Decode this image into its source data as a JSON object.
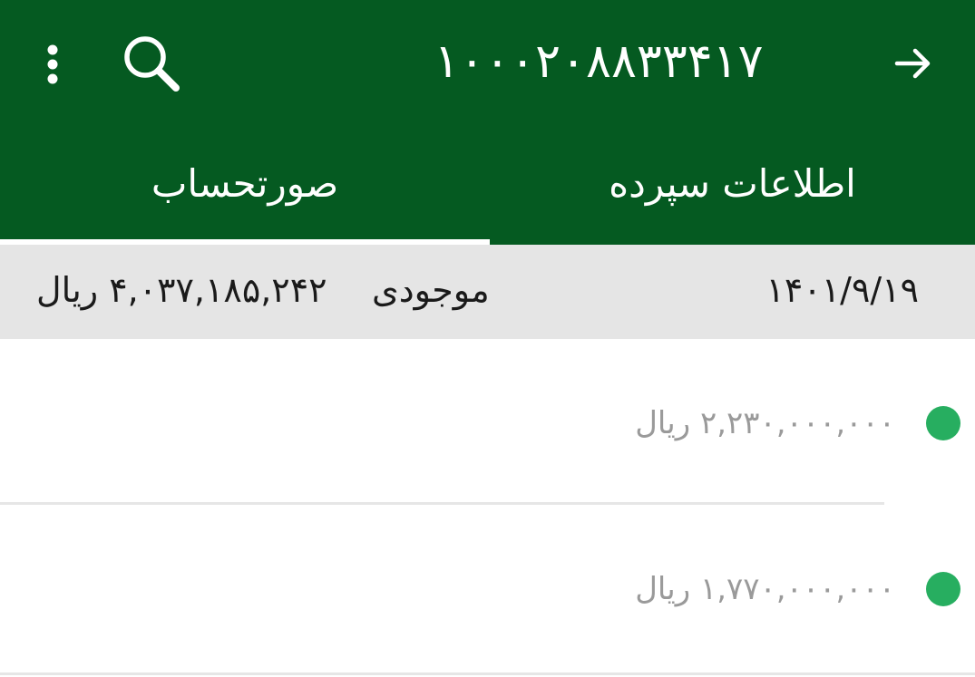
{
  "header": {
    "title": "۱۰۰۰۲۰۸۸۳۳۴۱۷",
    "back_icon": "arrow-forward-icon",
    "search_icon": "search-icon",
    "more_icon": "more-vertical-icon"
  },
  "tabs": [
    {
      "label": "اطلاعات سپرده",
      "selected": false
    },
    {
      "label": "صورتحساب",
      "selected": true
    }
  ],
  "summary": {
    "date": "۱۴۰۱/۹/۱۹",
    "balance_label": "موجودی",
    "balance_value": "۴,۰۳۷,۱۸۵,۲۴۲ ریال"
  },
  "transactions": [
    {
      "amount": "۲,۲۳۰,۰۰۰,۰۰۰ ریال",
      "status_color": "#27ae60"
    },
    {
      "amount": "۱,۷۷۰,۰۰۰,۰۰۰ ریال",
      "status_color": "#27ae60"
    }
  ],
  "colors": {
    "appbar": "#055a21",
    "summary_bg": "#e5e5e5",
    "status_dot": "#27ae60",
    "amount_text": "#9a9a9a"
  }
}
